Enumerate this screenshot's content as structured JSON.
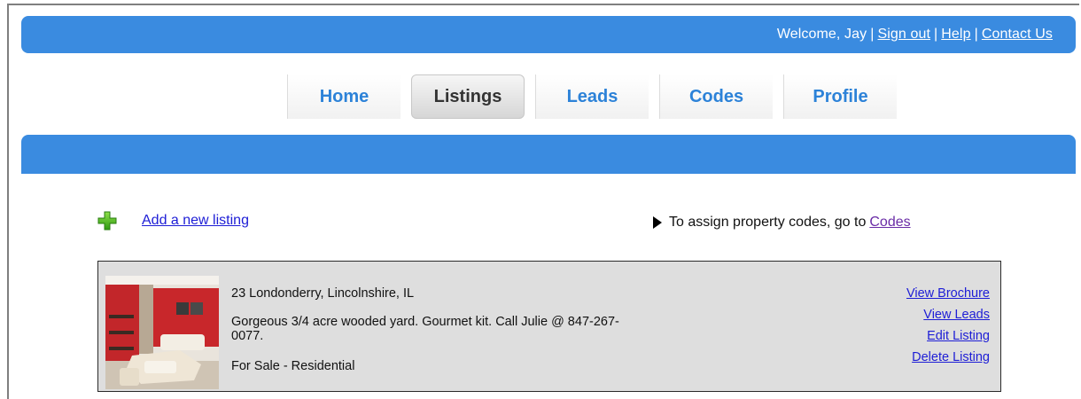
{
  "header": {
    "welcome": "Welcome, Jay",
    "sep": "|",
    "links": {
      "sign_out": "Sign out",
      "help": "Help",
      "contact_us": "Contact Us"
    }
  },
  "nav": {
    "tabs": [
      {
        "label": "Home",
        "active": false
      },
      {
        "label": "Listings",
        "active": true
      },
      {
        "label": "Leads",
        "active": false
      },
      {
        "label": "Codes",
        "active": false
      },
      {
        "label": "Profile",
        "active": false
      }
    ]
  },
  "actions": {
    "add_listing": "Add a new listing",
    "codes_hint": "To assign property codes, go to",
    "codes_link": "Codes"
  },
  "listing": {
    "address": "23 Londonderry, Lincolnshire, IL",
    "description": "Gorgeous 3/4 acre wooded yard. Gourmet kit. Call Julie @ 847-267-0077.",
    "status": "For Sale - Residential",
    "links": {
      "view_brochure": "View Brochure",
      "view_leads": "View Leads",
      "edit_listing": "Edit Listing",
      "delete_listing": "Delete Listing"
    }
  },
  "colors": {
    "header_blue": "#3a8be0",
    "tab_text": "#2c82d8",
    "link": "#1d1dd6",
    "visited_link": "#6a2ca6",
    "listing_bg": "#dedede"
  },
  "icons": {
    "add": "plus-icon",
    "hint": "triangle-right-icon"
  }
}
